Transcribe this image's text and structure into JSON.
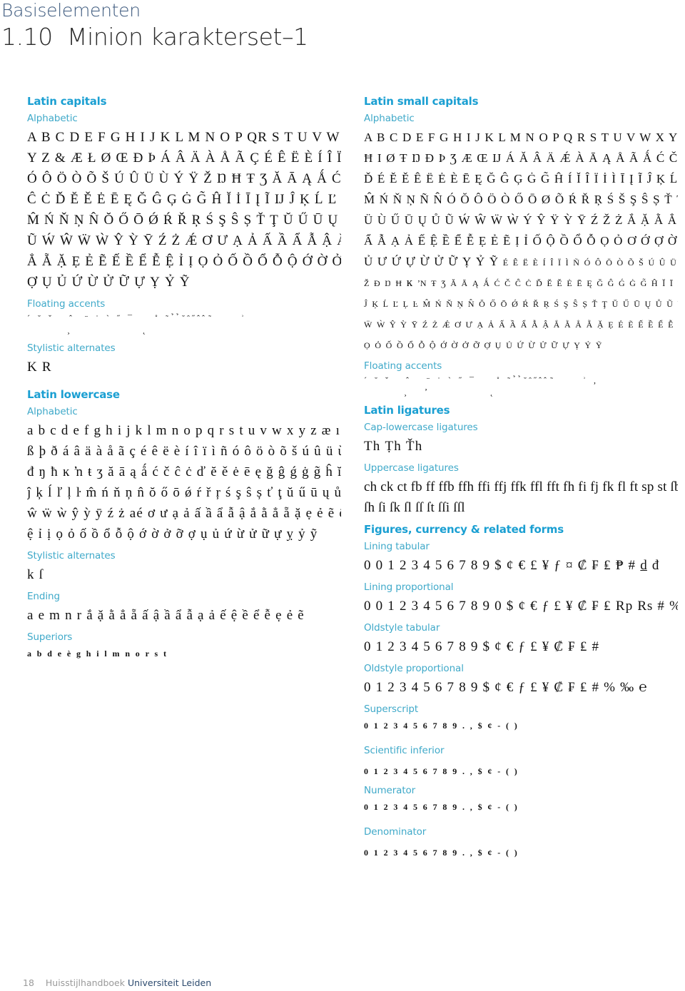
{
  "header": {
    "kicker": "Basiselementen",
    "title": "1.10  Minion karakterset–1"
  },
  "left": {
    "latin_capitals": {
      "title": "Latin capitals",
      "alphabetic_label": "Alphabetic",
      "alphabetic": [
        "A B C D E F G H I J K L M N O P QR S T U V W X",
        "Y Z & Æ Ł Ø Œ Ð  Þ Á Â Ä À Å Ã Ç É Ê Ë È Í Î Ï Ì Ñ",
        "Ó Ô Ö Ò Õ Š Ú Û Ü Ù Ý Ÿ Ž Ŋ Ħ Ŧ Ʒ Ă Ā Ą Ǻ Ć Č",
        "Ĉ Ċ Ď Ĕ Ě Ė Ē Ę Ğ Ĝ Ģ Ġ G̃ Ĥ Ĭ İ Ī Į Ĩ Ĳ Ĵ Ķ Ĺ Ľ Ļ Ŀ",
        "M̂ Ń Ň Ņ N̂ Ŏ Ő Ō Ǿ Ŕ Ř Ŗ Ś Ş Ŝ Ș Ť Ţ Ŭ Ű Ū Ų Ů",
        "Ũ Ẃ Ŵ Ẅ Ẁ Ŷ Ỳ Ȳ Ź Ż Ǽ Ơ Ư Ạ Ả Ấ Ầ Ẩ Ẫ Ậ Ắ Ằ",
        "Ẳ Ẵ Ặ Ẹ Ẻ Ẽ Ế Ề Ể Ễ Ệ Ỉ Ị Ọ Ỏ Ố Ồ Ổ Ỗ Ộ Ớ Ờ Ở Ỡ",
        "Ợ Ụ Ủ Ứ Ừ Ử Ữ Ự Ỵ Ỷ Ỹ"
      ],
      "floating_accents_label": "Floating accents",
      "floating_accents": [
        "´ ˘ ˇ   ˆ  ¨ ˙ ` ˝ ¯    ˚ ˜ ̉ ̉ ̆ ̑ ̋ ̂ ̂ ̃      ʾ",
        "        ¸              ˛                                      ."
      ],
      "stylistic_alternates_label": "Stylistic alternates",
      "stylistic_alternates": "K R"
    },
    "latin_lowercase": {
      "title": "Latin lowercase",
      "alphabetic_label": "Alphabetic",
      "alphabetic": [
        "a b c d e f g h i j k l m n o p q r s t u v w x y z æ ı ł ø oe",
        "ß þ ð á â ä à å ã ç é ê ë è í î ï ì ñ ó ô ö ò õ š ú û ü ù ý ÿ ž",
        "đ ŋ ħ ĸ ŉ ŧ ʒ ă ā ą ǻ ć č ĉ ċ ď ĕ ě ė ē ę ğ ĝ ǵ ġ g̃ ĥ ĭ ī į ĩ ĳ",
        "ĵ ķ ĺ ľ ļ ŀ m̂ ń ň ņ n̂ ŏ ő ō ǿ ŕ ř ŗ ś ş ŝ ș ť ţ ŭ ű ū ų ů ũ ẃ",
        "ŵ ẅ ẁ ŷ ỳ ȳ ź ż aé ơ ư ạ ả ấ ầ ẩ ẫ ậ ắ ằ ẳ ẵ ặ ẹ ẻ ẽ ế ề ể ễ",
        "ệ ỉ ị ọ ỏ ố ồ ổ ỗ ộ ớ ờ ở ỡ ợ ụ ủ ứ ừ ử ữ ự ỵ ỷ ỹ"
      ],
      "stylistic_alternates_label": "Stylistic alternates",
      "stylistic_alternates": "k ſ",
      "ending_label": "Ending",
      "ending": "a e m n r ắ ặ ằ ẳ ẵ ấ ậ ầ ẩ ẫ ạ ả ế ệ ề ể ễ ẹ ẻ ẽ",
      "superiors_label": "Superiors",
      "superiors": "a b d e è g h i l m n o r s t"
    }
  },
  "right": {
    "latin_small_capitals": {
      "title": "Latin small capitals",
      "alphabetic_label": "Alphabetic",
      "alphabetic": [
        "A B C D E F G H I J K L M N O P Q R S T U V W X Y Z & Ð",
        "Ħ I Ø Ŧ Ŋ Ð Þ Ʒ Æ Œ Ĳ Á Ă Â Ä Ǽ À Ā Ą Å Ã Ǻ Ć Č Ç Ĉ Ċ",
        "Ď É Ĕ Ě Ê Ë Ė È Ē Ę Ğ Ĝ Ģ Ġ G̃ Ĥ Í Ĭ Î Ï İ Ì Ī Į Ĩ Ĵ Ķ Ĺ Ľ Ļ Ŀ Ł",
        "M̂ Ń Ň Ņ Ñ N̂ Ó Ŏ Ô Ö Ò Ő Ō Ø Õ Ŕ Ř Ŗ Ś Š Ş Ŝ Ș Ť Ţ Ú Ŭ Û",
        "Ü Ù Ű Ū Ų Ů Ũ Ẃ Ŵ Ẅ Ẁ Ý Ŷ Ÿ Ỳ Ȳ Ź Ž Ż Ắ Ặ Ằ Ẳ Ẵ Ấ Ậ Ầ",
        "Ẩ Ẫ Ạ Ả Ế Ệ Ề Ể Ễ Ẹ Ẻ Ẽ Ị Ỉ Ố Ộ Ồ Ổ Ỗ Ọ Ỏ Ơ Ớ Ợ Ờ Ở Ỡ Ụ",
        "Ủ Ư Ứ Ự Ừ Ử Ữ Ỵ Ỷ Ỹ é ê ë è í î ï ì ñ ó ô ö ò õ š ú û ü ù ý ÿ",
        "ž đ ŋ ħ ĸ ŉ ŧ ʒ ă ā ą ǻ ć č ĉ ċ ď ĕ ě ė ē ę ğ ĝ ǵ ġ g̃ ĥ ĭ ī į ĩ ĳ",
        "ĵ ķ ĺ ľ ļ ŀ m̂ ń ň ņ n̂ ŏ ő ō ǿ ŕ ř ŗ ś ş ŝ ș ť ţ ŭ ű ū ų ů ũ ẃ ŵ",
        "ẅ ẁ ŷ ỳ ȳ ź ż ǽ ơ ư ạ ả ấ ầ ẩ ẫ ậ ắ ằ ẳ ẵ ặ ẹ ẻ ẽ ế ề ể ễ ệ ỉ ị",
        "ọ ỏ ố ồ ổ ỗ ộ ớ ờ ở ỡ ợ ụ ủ ứ ừ ử ữ ự ỵ ỷ ỹ"
      ],
      "floating_accents_label": "Floating accents",
      "floating_accents": [
        "´ ˘ ˇ   ˆ   ¨ ˙ ` ˝ ¯    ˚ ˜ ̉ ̉ ̆ ̑ ̋ ̂ ̂ ̃      ʾ ,",
        "        ¸   ʼ            ˛                                      ."
      ]
    },
    "latin_ligatures": {
      "title": "Latin ligatures",
      "cap_lowercase_label": "Cap-lowercase ligatures",
      "cap_lowercase": "Th Ṭh Ťh",
      "uppercase_label": "Uppercase ligatures",
      "uppercase": [
        "ch ck ct fb ff ffb ffh ffi ffj ffk ffl fft fh fi fj fk fl ft sp st ſb",
        "ſh ſi ſk ſl ſſ ſt ſſi ſſl"
      ]
    },
    "figures": {
      "title": "Figures, currency & related forms",
      "lining_tabular_label": "Lining tabular",
      "lining_tabular": "0 0 1 2 3 4 5 6 7 8 9 $ ¢ € £ ¥ ƒ ¤ ₡ ₣ ₤ ₱ # d̲ đ",
      "lining_proportional_label": "Lining proportional",
      "lining_proportional": "0 0 1 2 3 4 5 6 7 8 9 0 $ ¢ € ƒ £ ¥ ₡ ₣ ₤ Rp ₨ # % ‰",
      "oldstyle_tabular_label": "Oldstyle tabular",
      "oldstyle_tabular": "0 1 2 3 4 5 6 7 8 9 $ ¢ € ƒ £ ¥ ₡ ₣ ₤ #",
      "oldstyle_proportional_label": "Oldstyle proportional",
      "oldstyle_proportional": "0 1 2 3 4 5 6 7 8 9 $ ¢ € ƒ £ ¥ ₡ ₣ ₤ # % ‰ ℮",
      "superscript_label": "Superscript",
      "superscript": "0 1 2 3 4 5 6 7 8 9 . , $ ¢ - ( )",
      "scientific_inferior_label": "Scientific inferior",
      "scientific_inferior": "0 1 2 3 4 5 6 7 8 9 . , $ ¢ - ( )",
      "numerator_label": "Numerator",
      "numerator": "0 1 2 3 4 5 6 7 8 9 . , $ ¢ - ( )",
      "denominator_label": "Denominator",
      "denominator": "0 1 2 3 4 5 6 7 8 9 . , $ ¢ - ( )"
    }
  },
  "footer": {
    "page_number": "18",
    "publication": "Huisstijlhandboek",
    "brand": "Universiteit Leiden"
  }
}
